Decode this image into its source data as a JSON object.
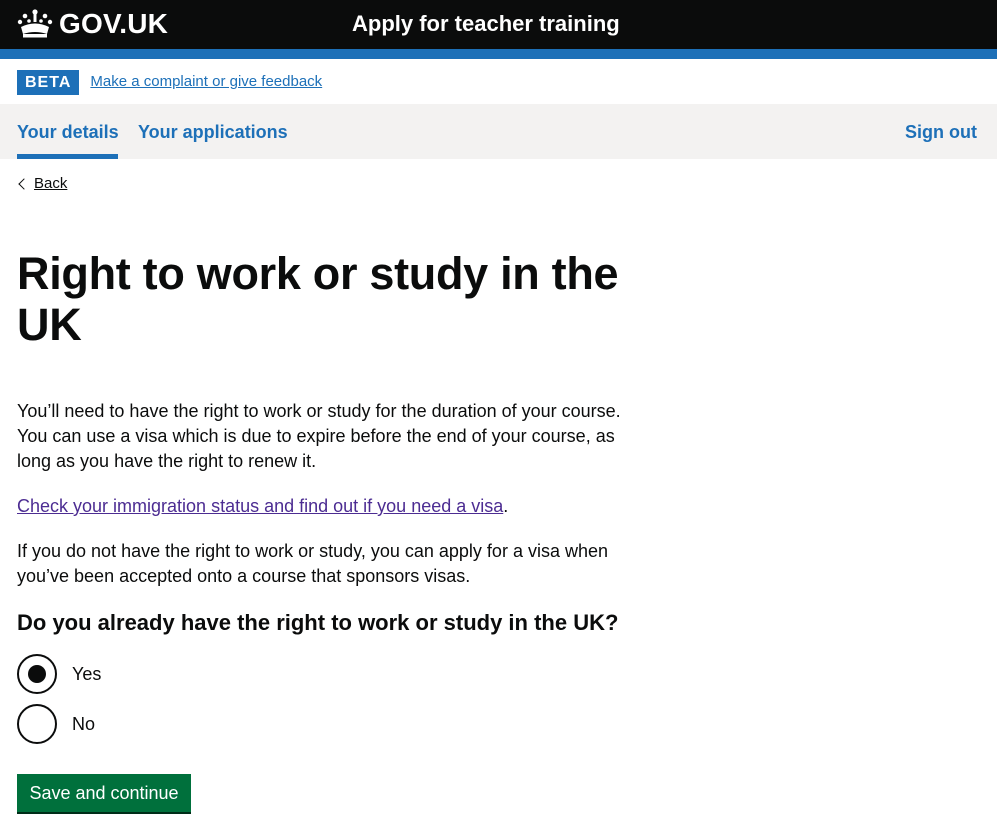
{
  "header": {
    "logo_text": "GOV.UK",
    "service_name": "Apply for teacher training"
  },
  "phase_banner": {
    "tag": "BETA",
    "link": "Make a complaint or give feedback"
  },
  "nav": {
    "items": [
      {
        "label": "Your details",
        "active": true
      },
      {
        "label": "Your applications",
        "active": false
      }
    ],
    "sign_out": "Sign out"
  },
  "back_link": "Back",
  "page_title": "Right to work or study in the UK",
  "body": {
    "paragraph_1": "You’ll need to have the right to work or study for the duration of your course. You can use a visa which is due to expire before the end of your course, as long as you have the right to renew it.",
    "immigration_link": "Check your immigration status and find out if you need a visa",
    "immigration_link_suffix": ".",
    "paragraph_3": "If you do not have the right to work or study, you can apply for a visa when you’ve been accepted onto a course that sponsors visas."
  },
  "question": {
    "legend": "Do you already have the right to work or study in the UK?",
    "options": [
      {
        "label": "Yes",
        "selected": true
      },
      {
        "label": "No",
        "selected": false
      }
    ]
  },
  "submit_button": "Save and continue",
  "colors": {
    "header_bg": "#0b0c0c",
    "brand_blue": "#1d70b8",
    "button_green": "#00703c",
    "visited_link": "#4c2c92",
    "nav_bg": "#f3f2f1"
  },
  "icons": {
    "logo": "crown-icon",
    "back": "chevron-left-icon"
  }
}
